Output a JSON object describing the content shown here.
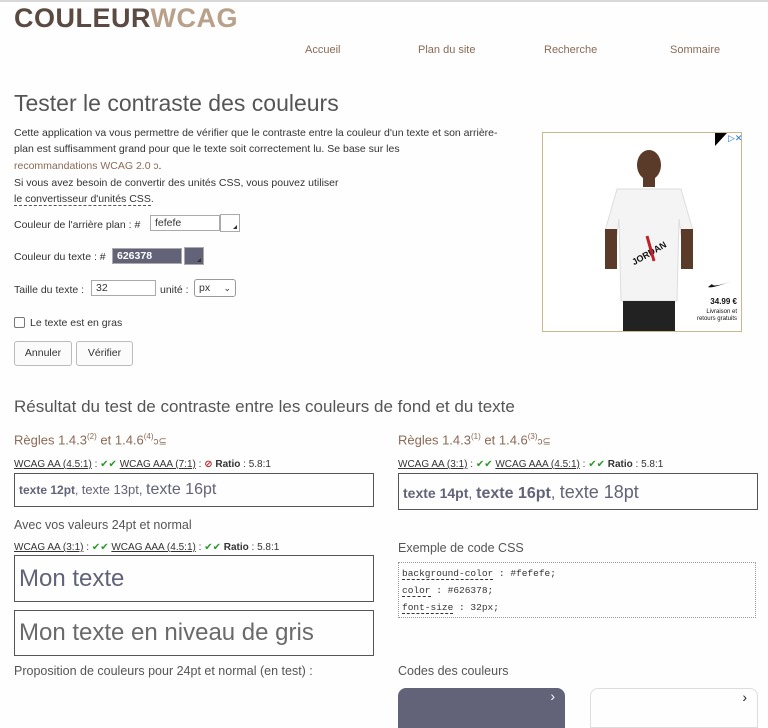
{
  "logo": {
    "part1": "COULEUR",
    "part2": "WCAG"
  },
  "nav": [
    "Accueil",
    "Plan du site",
    "Recherche",
    "Sommaire"
  ],
  "title": "Tester le contraste des couleurs",
  "intro": {
    "p1": "Cette application va vous permettre de vérifier que le contraste entre la couleur d'un texte et son arrière-plan est suffisamment grand pour que le texte soit correctement lu. Se base sur les",
    "link1": "recommandations WCAG 2.0",
    "p2": "Si vous avez besoin de convertir des unités CSS, vous pouvez utiliser",
    "link2": "le convertisseur d'unités CSS"
  },
  "ad": {
    "price": "34.99 €",
    "shipping1": "Livraison et",
    "shipping2": "retours gratuits"
  },
  "form": {
    "bg_label": "Couleur de l'arrière plan : #",
    "bg_value": "fefefe",
    "fg_label": "Couleur du texte : #",
    "fg_value": "626378",
    "size_label": "Taille du texte :",
    "size_value": "32",
    "unit_label": "unité :",
    "unit_value": "px",
    "bold_label": "Le texte est en gras",
    "cancel": "Annuler",
    "verify": "Vérifier"
  },
  "result": {
    "title": "Résultat du test de contraste entre les couleurs de fond et du texte",
    "left_rules": {
      "a": "Règles 1.4.3",
      "sa": "(2)",
      "b": " et 1.4.6",
      "sb": "(4)"
    },
    "right_rules": {
      "a": "Règles 1.4.3",
      "sa": "(1)",
      "b": " et 1.4.6",
      "sb": "(3)"
    },
    "left_line": {
      "aa": "WCAG AA (4.5:1)",
      "aaa": "WCAG AAA (7:1)",
      "ratio_label": "Ratio",
      "ratio": ": 5.8:1"
    },
    "right_line": {
      "aa": "WCAG AA (3:1)",
      "aaa": "WCAG AAA (4.5:1)",
      "ratio_label": "Ratio",
      "ratio": ": 5.8:1"
    },
    "left_sample": {
      "t1": "texte 12pt",
      "t2": "texte 13pt",
      "t3": "texte 16pt"
    },
    "right_sample": {
      "t1": "texte 14pt",
      "t2": "texte 16pt",
      "t3": "texte 18pt"
    },
    "yours_title": "Avec vos valeurs 24pt et normal",
    "yours_line": {
      "aa": "WCAG AA (3:1)",
      "aaa": "WCAG AAA (4.5:1)",
      "ratio_label": "Ratio",
      "ratio": ": 5.8:1"
    },
    "sample1": "Mon texte",
    "sample2": "Mon texte en niveau de gris",
    "css_title": "Exemple de code CSS",
    "css": {
      "bg": "background-color",
      "bgv": " : #fefefe;",
      "c": "color",
      "cv": " : #626378;",
      "fs": "font-size",
      "fsv": " : 32px;"
    },
    "proposal": "Proposition de couleurs pour 24pt et normal (en test) :",
    "codes": "Codes des couleurs"
  },
  "colors": {
    "fg": "#626378",
    "bg": "#fefefe",
    "accent": "#8a6a55"
  }
}
